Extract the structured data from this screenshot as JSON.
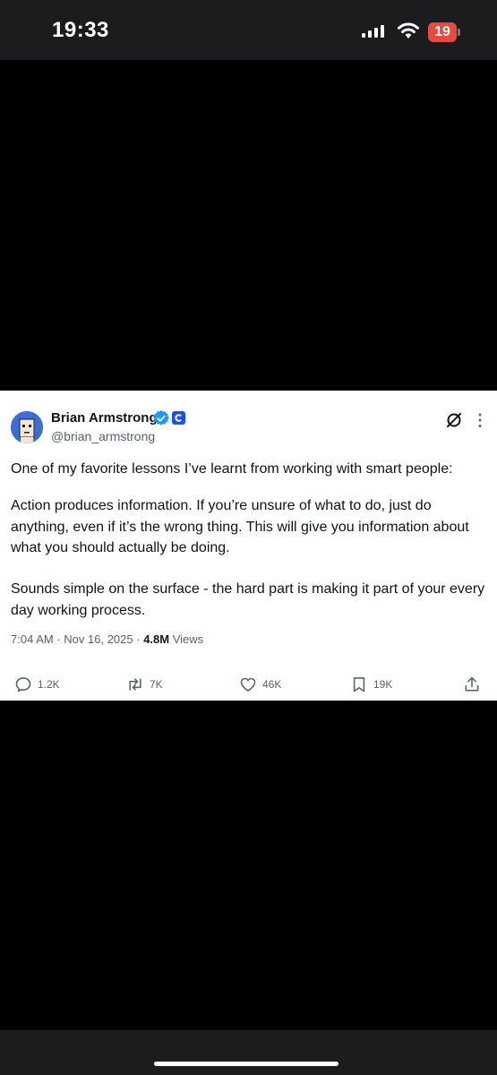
{
  "status_bar": {
    "time": "19:33",
    "battery": "19"
  },
  "tweet": {
    "author": {
      "name": "Brian Armstrong",
      "handle": "@brian_armstrong"
    },
    "paragraphs": [
      "One of my favorite lessons I’ve learnt from working with smart people:",
      "Action produces information. If you’re unsure of what to do, just do anything, even if it’s the wrong thing. This will give you information about what you should actually be doing.",
      "Sounds simple on the surface - the hard part is making it part of your every day working process."
    ],
    "meta": {
      "time": "7:04 AM",
      "separator": "·",
      "date": "Nov 16, 2025",
      "views_count": "4.8M",
      "views_label": "Views"
    },
    "actions": {
      "replies": "1.2K",
      "reposts": "7K",
      "likes": "46K",
      "bookmarks": "19K"
    }
  },
  "colors": {
    "verified": "#1d9bf0",
    "coinbase": "#1652f0",
    "battery": "#e84a3f"
  }
}
